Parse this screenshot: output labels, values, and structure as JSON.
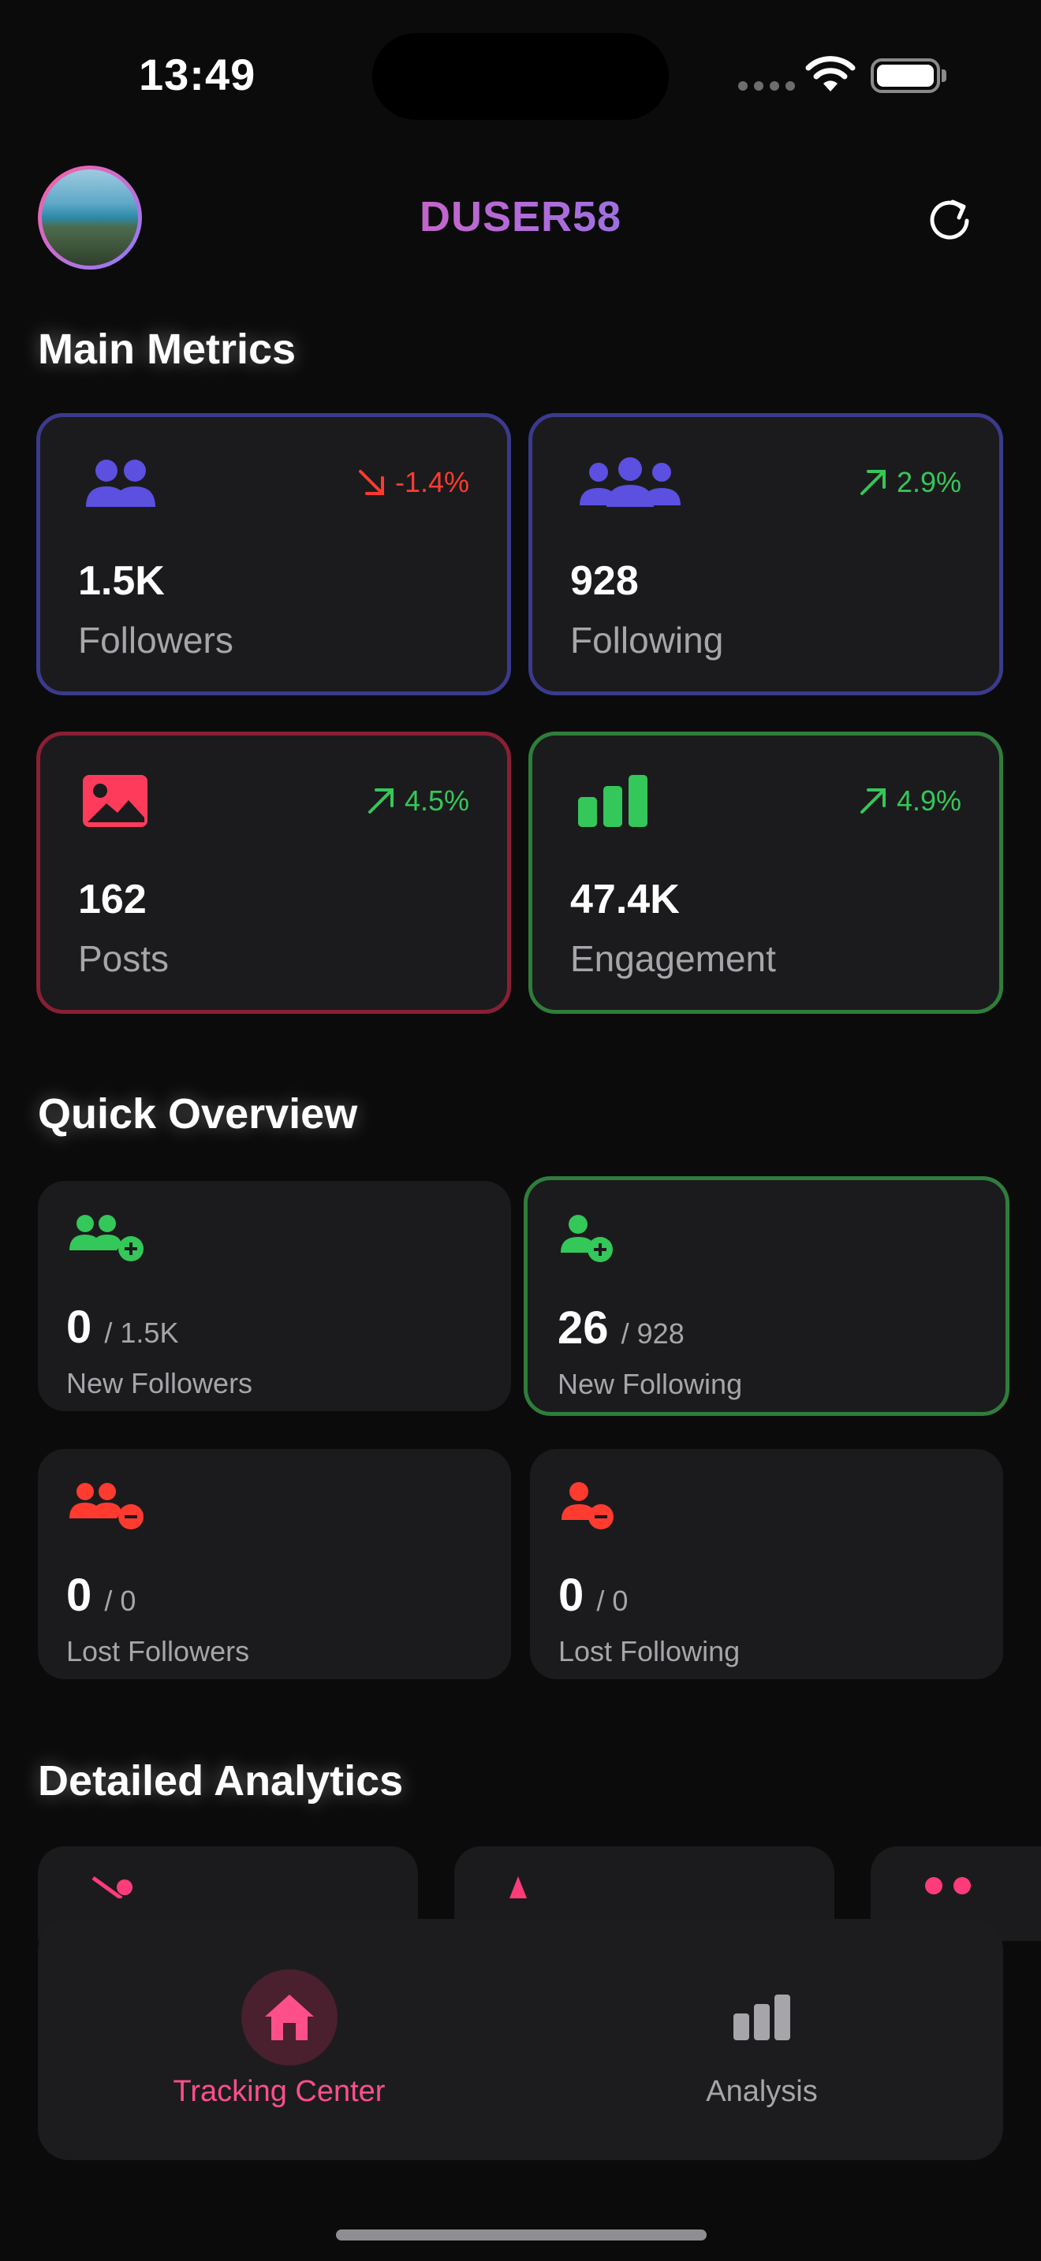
{
  "status_bar": {
    "time": "13:49"
  },
  "header": {
    "username": "DUSER58",
    "avatar_icon": "profile-photo",
    "refresh_icon": "refresh-icon"
  },
  "sections": {
    "main_metrics": "Main Metrics",
    "quick_overview": "Quick Overview",
    "detailed_analytics": "Detailed Analytics"
  },
  "metrics": [
    {
      "value": "1.5K",
      "label": "Followers",
      "change": "-1.4%",
      "trend": "down",
      "icon": "people-icon",
      "border": "#3b3a8c",
      "color": "#5b50e0"
    },
    {
      "value": "928",
      "label": "Following",
      "change": "2.9%",
      "trend": "up",
      "icon": "group-icon",
      "border": "#3b3a8c",
      "color": "#5b50e0"
    },
    {
      "value": "162",
      "label": "Posts",
      "change": "4.5%",
      "trend": "up",
      "icon": "image-icon",
      "border": "#8a1f34",
      "color": "#ff3b5c"
    },
    {
      "value": "47.4K",
      "label": "Engagement",
      "change": "4.9%",
      "trend": "up",
      "icon": "bar-chart-icon",
      "border": "#2f7d3a",
      "color": "#34c759"
    }
  ],
  "overview": [
    {
      "count": "0",
      "total": "/ 1.5K",
      "label": "New Followers",
      "icon": "people-add-icon",
      "color": "#34c759"
    },
    {
      "count": "26",
      "total": "/ 928",
      "label": "New Following",
      "icon": "person-add-icon",
      "color": "#34c759"
    },
    {
      "count": "0",
      "total": "/ 0",
      "label": "Lost Followers",
      "icon": "people-remove-icon",
      "color": "#ff3b30"
    },
    {
      "count": "0",
      "total": "/ 0",
      "label": "Lost Following",
      "icon": "person-remove-icon",
      "color": "#ff3b30"
    }
  ],
  "nav": {
    "items": [
      {
        "label": "Tracking Center",
        "icon": "home-icon",
        "active": true
      },
      {
        "label": "Analysis",
        "icon": "bar-chart-icon",
        "active": false
      }
    ]
  },
  "colors": {
    "accent": "#ff4f8b",
    "up": "#34c759",
    "down": "#ff3b30",
    "inactive": "#a6a6aa"
  }
}
